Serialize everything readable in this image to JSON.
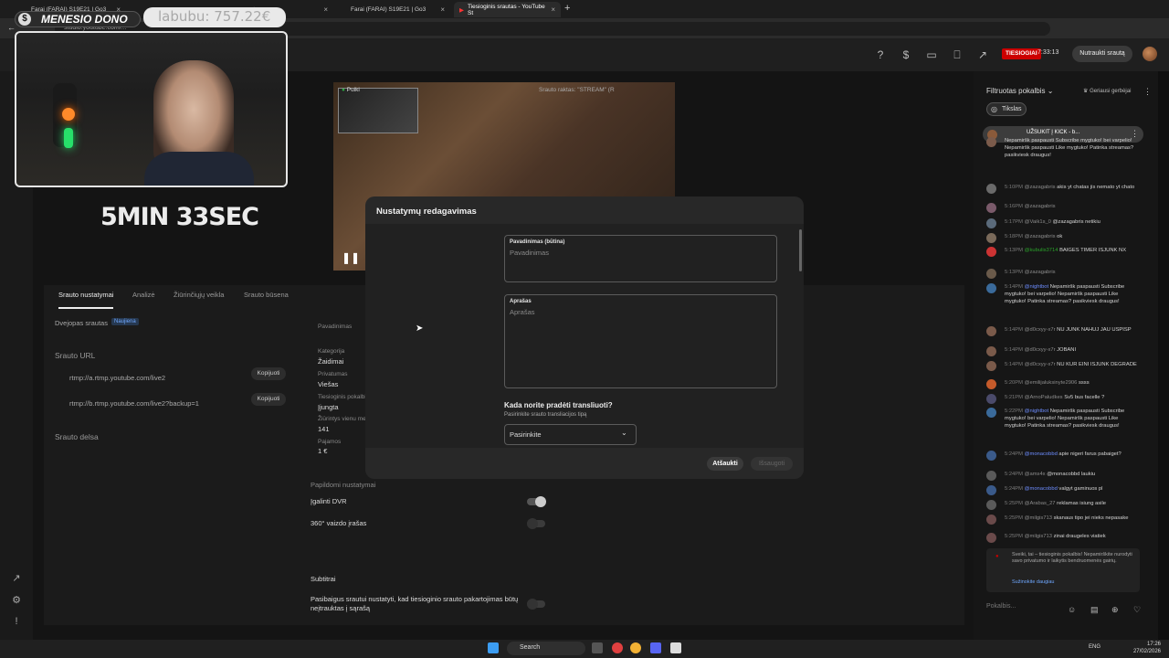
{
  "browser": {
    "tabs": [
      {
        "label": "Farai (FARAI) S19E21 | Go3"
      },
      {
        "label": "receptas"
      },
      {
        "label": "Farai (FARAI) S19E21 | Go3"
      },
      {
        "label": "Tiesioginis srautas - YouTube St"
      }
    ],
    "url": "studio.youtube.com/..."
  },
  "overlay": {
    "channel": "MENESIO DONO",
    "donation": "labubu: 757.22€",
    "timer": "5MIN 33SEC"
  },
  "header": {
    "live_badge": "TIESIOGIAI",
    "live_time": "7:33:13",
    "end_button": "Nutraukti srautą"
  },
  "preview": {
    "status": "Puiki",
    "stream_key_label": "Srauto raktas: \"STREAM\" (R"
  },
  "panel": {
    "tabs": [
      "Srauto nustatymai",
      "Analizė",
      "Žiūrinčiųjų veikla",
      "Srauto būsena"
    ],
    "dual": "Dvejopas srautas",
    "dual_badge": "Naujiena",
    "url_heading": "Srauto URL",
    "url1": "rtmp://a.rtmp.youtube.com/live2",
    "url2": "rtmp://b.rtmp.youtube.com/live2?backup=1",
    "copy": "Kopijuoti",
    "delay_heading": "Srauto delsa",
    "info": {
      "name_label": "Pavadinimas",
      "category_label": "Kategorija",
      "category": "Žaidimai",
      "privacy_label": "Privatumas",
      "privacy": "Viešas",
      "chat_label": "Tiesioginis pokalbis",
      "chat": "Įjungta",
      "viewers_label": "Žiūrintys vienu metu",
      "viewers": "141",
      "revenue_label": "Pajamos",
      "revenue": "1 €"
    },
    "extra_heading": "Papildomi nustatymai",
    "dvr": "Įgalinti DVR",
    "vr": "360° vaizdo įrašas",
    "subs": "Subtitrai",
    "replay": "Pasibaigus srautui nustatyti, kad tiesioginio srauto pakartojimas būtų neįtrauktas į sąrašą"
  },
  "modal": {
    "title": "Nustatymų redagavimas",
    "title_field_label": "Pavadinimas (būtina)",
    "title_placeholder": "Pavadinimas",
    "desc_label": "Aprašas",
    "desc_placeholder": "Aprašas",
    "when_question": "Kada norite pradėti transliuoti?",
    "when_sub": "Pasirinkite srauto transliacijos tipą",
    "select_value": "Pasirinkite",
    "cancel": "Atšaukti",
    "save": "Išsaugoti"
  },
  "chat": {
    "header": "Filtruotas pokalbis",
    "top_fans": "Geriausi gerbėjai",
    "chip": "Tikslas",
    "pinned": "UŽSUKIT Į KICK - b...",
    "messages": [
      {
        "time": "",
        "user": "",
        "text": "Nepamiršk paspausti Subscribe mygtuko! bei varpelio! Nepamiršk paspausti Like mygtuko! Patinka streamas? pasikviesk draugus!"
      },
      {
        "time": "5:10PM",
        "user": "@zazagabris",
        "text": "akis yt chatas jis nemato yt chato"
      },
      {
        "time": "5:16PM",
        "user": "@zazagabris",
        "text": ""
      },
      {
        "time": "5:17PM",
        "user": "@Vaik1s_0",
        "text": "@zazagabris netikiu"
      },
      {
        "time": "5:18PM",
        "user": "@zazagabris",
        "text": "ok"
      },
      {
        "time": "5:13PM",
        "user": "@kubulis3714",
        "text": "BAIGES TIMER ISJUNK NX"
      },
      {
        "time": "5:13PM",
        "user": "@zazagabris",
        "text": ""
      },
      {
        "time": "5:14PM",
        "user": "@nightbot",
        "text": "Nepamiršk paspausti Subscribe mygtuko! bei varpelio! Nepamiršk paspausti Like mygtuko! Patinka streamas? pasikviesk draugus!"
      },
      {
        "time": "5:14PM",
        "user": "@d0cxyy-x7r",
        "text": "NU JUNK NAHUJ JAU USPISP"
      },
      {
        "time": "5:14PM",
        "user": "@d0cxyy-x7r",
        "text": "JOBANI"
      },
      {
        "time": "5:14PM",
        "user": "@d0cxyy-x7r",
        "text": "NU KUR EINI ISJUNK DEGRADE"
      },
      {
        "time": "5:20PM",
        "user": "@emilijaluksinyte2906",
        "text": "ssss"
      },
      {
        "time": "5:21PM",
        "user": "@ArnoPaludkes",
        "text": "Sv5 bus facelle ?"
      },
      {
        "time": "5:22PM",
        "user": "@nightbot",
        "text": "Nepamiršk paspausti Subscribe mygtuko! bei varpelio! Nepamiršk paspausti Like mygtuko! Patinka streamas? pasikviesk draugus!"
      },
      {
        "time": "5:24PM",
        "user": "@monacobbd",
        "text": "apie nigeri farus pabaiget?"
      },
      {
        "time": "5:24PM",
        "user": "@ams4x",
        "text": "@monacobbd laukiu"
      },
      {
        "time": "5:24PM",
        "user": "@monacobbd",
        "text": "valgyt gaminuos pl"
      },
      {
        "time": "5:25PM",
        "user": "@Arabas_27",
        "text": "reklamas isiung asile"
      },
      {
        "time": "5:25PM",
        "user": "@milgis713",
        "text": "skanaus tipo jei nieks nepasake"
      },
      {
        "time": "5:25PM",
        "user": "@milgis713",
        "text": "zinai draugeles viatiek"
      }
    ],
    "info": "Sveiki, tai – tiesioginis pokalbis! Nepamirškite nurodyti savo privatumo ir laikytis bendruomenės gairių.",
    "info_link": "Sužinokite daugiau",
    "input_placeholder": "Pokalbis..."
  },
  "taskbar": {
    "search": "Search",
    "lang": "ENG",
    "time": "17:26",
    "date": "27/02/2026"
  }
}
